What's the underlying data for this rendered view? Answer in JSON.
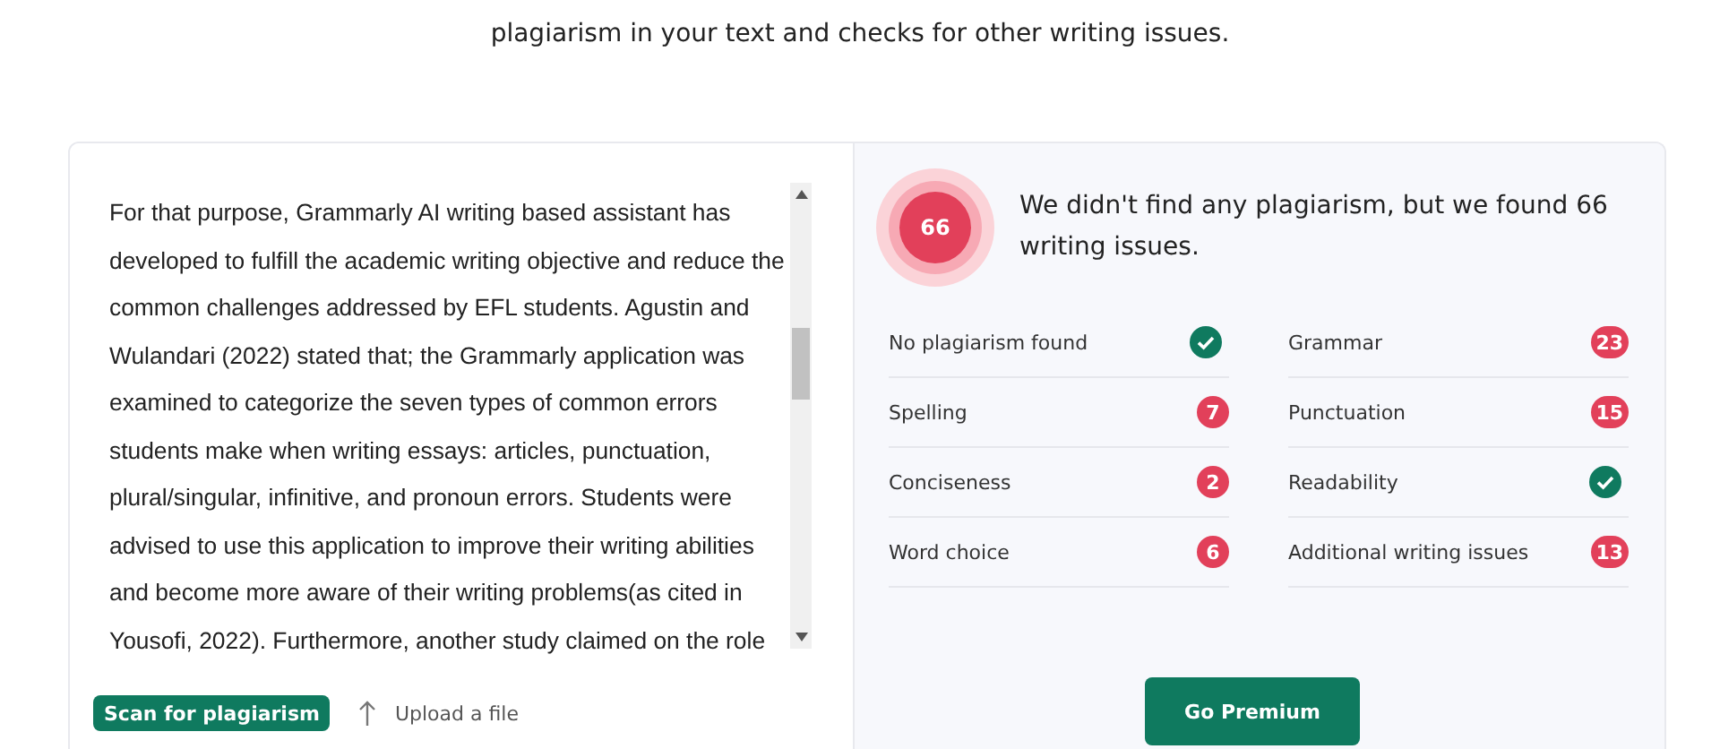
{
  "intro": "plagiarism in your text and checks for other writing issues.",
  "editor": {
    "lines": [
      "For that purpose, Grammarly AI writing based assistant has",
      "developed to fulfill the academic writing objective and reduce the",
      "common challenges addressed by EFL students. Agustin and",
      "Wulandari (2022) stated that; the Grammarly application  was",
      "examined to categorize the seven types of common errors",
      "students make when writing essays: articles, punctuation,",
      "plural/singular, infinitive, and pronoun errors. Students were",
      "advised to use this application to improve their writing abilities",
      "and become more aware of their writing problems(as cited in",
      "Yousofi, 2022). Furthermore, another study claimed on the role"
    ],
    "scan_button": "Scan for plagiarism",
    "upload_link": "Upload a file"
  },
  "result": {
    "score": "66",
    "message": "We didn't find any plagiarism, but we found 66 writing issues.",
    "checks": [
      {
        "label": "No plagiarism found",
        "kind": "ok"
      },
      {
        "label": "Grammar",
        "kind": "count",
        "count": "23"
      },
      {
        "label": "Spelling",
        "kind": "count",
        "count": "7"
      },
      {
        "label": "Punctuation",
        "kind": "count",
        "count": "15"
      },
      {
        "label": "Conciseness",
        "kind": "count",
        "count": "2"
      },
      {
        "label": "Readability",
        "kind": "ok"
      },
      {
        "label": "Word choice",
        "kind": "count",
        "count": "6"
      },
      {
        "label": "Additional writing issues",
        "kind": "count",
        "count": "13"
      }
    ],
    "premium_button": "Go Premium"
  }
}
